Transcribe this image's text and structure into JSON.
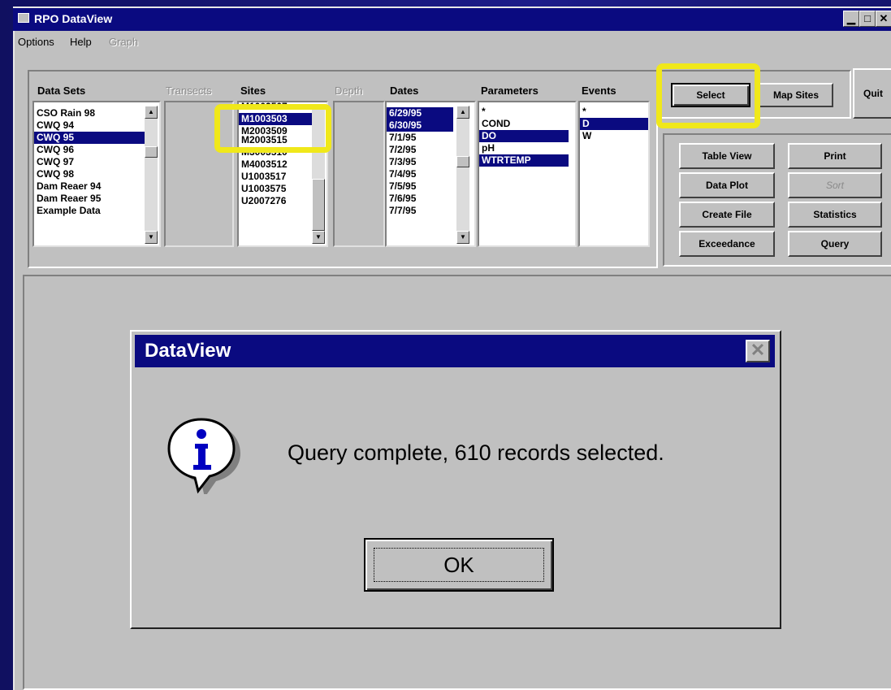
{
  "window": {
    "title": "RPO DataView",
    "buttons": [
      "▁",
      "□",
      "✕"
    ]
  },
  "menu": {
    "items": [
      "Options",
      "Help"
    ],
    "disabled_item": "Graph"
  },
  "panels": {
    "data_sets": {
      "label": "Data Sets",
      "items": [
        "CSO Rain 98",
        "CWQ 94",
        "CWQ 95",
        "CWQ 96",
        "CWQ 97",
        "CWQ 98",
        "Dam Reaer 94",
        "Dam Reaer 95",
        "Example Data"
      ],
      "selected": [
        2
      ]
    },
    "transects": {
      "label": "Transects"
    },
    "sites": {
      "label": "Sites",
      "items": [
        "M1003507",
        "M1003503",
        "M2003509",
        "M2003515",
        "M3003510",
        "M4003512",
        "U1003517",
        "U1003575",
        "U2007276"
      ],
      "selected": [
        1
      ]
    },
    "depth": {
      "label": "Depth"
    },
    "dates": {
      "label": "Dates",
      "items": [
        "6/29/95",
        "6/30/95",
        "7/1/95",
        "7/2/95",
        "7/3/95",
        "7/4/95",
        "7/5/95",
        "7/6/95",
        "7/7/95"
      ],
      "selected": [
        0,
        1
      ]
    },
    "parameters": {
      "label": "Parameters",
      "items": [
        "*",
        "COND",
        "DO",
        "pH",
        "WTRTEMP"
      ],
      "selected": [
        2,
        4
      ]
    },
    "events": {
      "label": "Events",
      "items": [
        "*",
        "D",
        "W"
      ],
      "selected": [
        1
      ]
    }
  },
  "buttons": {
    "select": "Select",
    "map_sites": "Map Sites",
    "quit": "Quit",
    "table_view": "Table View",
    "print": "Print",
    "data_plot": "Data Plot",
    "sort": "Sort",
    "create_file": "Create File",
    "statistics": "Statistics",
    "exceedance": "Exceedance",
    "query": "Query"
  },
  "dialog": {
    "title": "DataView",
    "message": "Query complete, 610 records selected.",
    "ok": "OK",
    "icon": "info-icon"
  },
  "colors": {
    "selection": "#0a0a80",
    "highlight": "#f0e81a",
    "window_bg": "#c0c0c0"
  }
}
